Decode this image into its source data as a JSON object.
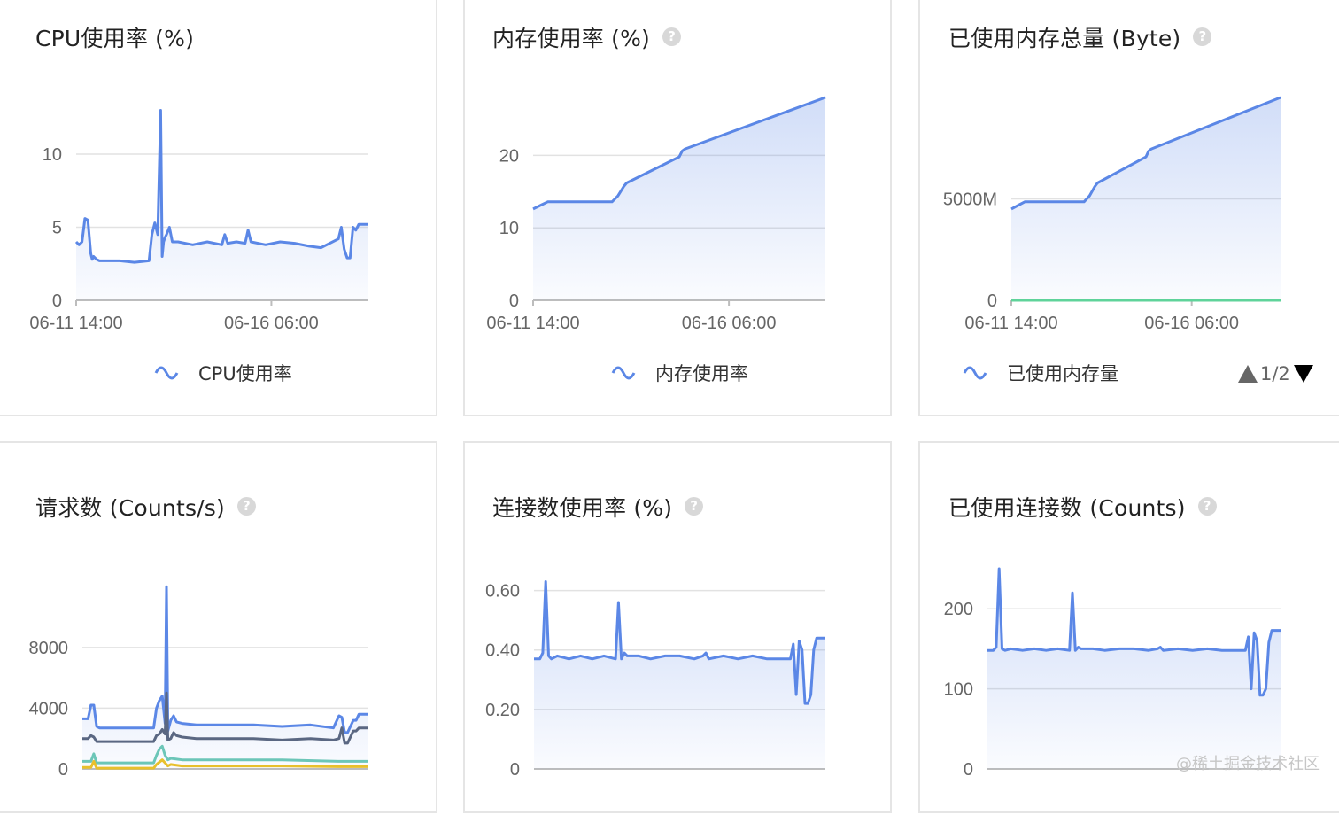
{
  "watermark": "@稀土掘金技术社区",
  "colors": {
    "blue": "#5b87e6",
    "green": "#5fd39a",
    "dark": "#5a6782",
    "teal": "#6cc6b8",
    "yellow": "#e8c02c",
    "grid": "#e2e2e2"
  },
  "panels": [
    {
      "title": "CPU使用率 (%)",
      "help": false,
      "legend": "CPU使用率"
    },
    {
      "title": "内存使用率 (%)",
      "help": true,
      "legend": "内存使用率"
    },
    {
      "title": "已使用内存总量 (Byte)",
      "help": true,
      "legend": "已使用内存量",
      "pager": "1/2"
    },
    {
      "title": "请求数 (Counts/s)",
      "help": true
    },
    {
      "title": "连接数使用率 (%)",
      "help": true
    },
    {
      "title": "已使用连接数 (Counts)",
      "help": true
    }
  ],
  "help_glyph": "?",
  "chart_data": [
    {
      "type": "line",
      "title": "CPU使用率 (%)",
      "ylim": [
        0,
        14
      ],
      "yticks": [
        0,
        5,
        10
      ],
      "ytick_labels": [
        "0",
        "5",
        "10"
      ],
      "xlim": [
        0,
        100
      ],
      "xticks": [
        0,
        67
      ],
      "xtick_labels": [
        "06-11 14:00",
        "06-16 06:00"
      ],
      "series": [
        {
          "name": "CPU使用率",
          "color": "#5b87e6",
          "x": [
            0,
            1,
            2,
            3,
            4,
            5,
            5.5,
            6,
            7,
            8,
            10,
            15,
            20,
            25,
            26,
            27,
            28,
            29,
            29.5,
            30,
            30.5,
            31,
            32,
            33,
            34,
            35,
            40,
            45,
            50,
            51,
            52,
            55,
            58,
            59,
            60,
            65,
            70,
            75,
            80,
            84,
            90,
            91,
            92,
            93,
            94,
            95,
            96,
            97,
            98,
            100
          ],
          "y": [
            4,
            3.8,
            4,
            5.6,
            5.5,
            3.2,
            2.8,
            3.0,
            2.8,
            2.7,
            2.7,
            2.7,
            2.6,
            2.7,
            4.5,
            5.3,
            4.5,
            13,
            3,
            4,
            4.3,
            4.5,
            5,
            4,
            4,
            4,
            3.8,
            4,
            3.8,
            4.5,
            3.9,
            4,
            3.9,
            4.8,
            4,
            3.8,
            4,
            3.9,
            3.7,
            3.6,
            4.2,
            5,
            3.5,
            2.9,
            2.9,
            5,
            4.8,
            5.2,
            5.2,
            5.2
          ]
        }
      ]
    },
    {
      "type": "area",
      "title": "内存使用率 (%)",
      "ylim": [
        0,
        28
      ],
      "yticks": [
        0,
        10,
        20
      ],
      "ytick_labels": [
        "0",
        "10",
        "20"
      ],
      "xlim": [
        0,
        100
      ],
      "xticks": [
        0,
        67
      ],
      "xtick_labels": [
        "06-11 14:00",
        "06-16 06:00"
      ],
      "series": [
        {
          "name": "内存使用率",
          "color": "#5b87e6",
          "x": [
            0,
            3,
            5,
            27,
            29,
            31,
            32,
            50,
            51,
            52,
            100
          ],
          "y": [
            12.6,
            13.2,
            13.6,
            13.6,
            14.4,
            15.7,
            16.2,
            19.8,
            20.6,
            20.9,
            28
          ]
        }
      ]
    },
    {
      "type": "area",
      "title": "已使用内存总量 (Byte)",
      "ylim": [
        0,
        14000
      ],
      "yticks": [
        0,
        7000
      ],
      "ytick_labels": [
        "0",
        "5000M"
      ],
      "xlim": [
        0,
        100
      ],
      "xticks": [
        0,
        67
      ],
      "xtick_labels": [
        "06-11 14:00",
        "06-16 06:00"
      ],
      "series": [
        {
          "name": "已使用内存量",
          "color": "#5b87e6",
          "x": [
            0,
            3,
            5,
            27,
            29,
            31,
            32,
            50,
            51,
            52,
            100
          ],
          "y": [
            6300,
            6600,
            6800,
            6800,
            7200,
            7850,
            8100,
            9900,
            10300,
            10450,
            14000
          ]
        },
        {
          "name": "",
          "color": "#5fd39a",
          "x": [
            0,
            100
          ],
          "y": [
            0,
            0
          ]
        }
      ]
    },
    {
      "type": "line",
      "title": "请求数 (Counts/s)",
      "ylim": [
        0,
        14000
      ],
      "yticks": [
        0,
        4000,
        8000
      ],
      "ytick_labels": [
        "0",
        "4000",
        "8000"
      ],
      "xlim": [
        0,
        100
      ],
      "xticks": [],
      "xtick_labels": [],
      "series": [
        {
          "name": "",
          "color": "#5b87e6",
          "x": [
            0,
            2,
            3,
            4,
            5,
            6,
            10,
            20,
            25,
            26,
            27,
            28,
            29,
            29.5,
            30,
            31,
            32,
            33,
            35,
            40,
            50,
            60,
            70,
            80,
            88,
            90,
            91,
            92,
            93,
            95,
            96,
            97,
            100
          ],
          "y": [
            3300,
            3300,
            4200,
            4200,
            2800,
            2700,
            2700,
            2700,
            2700,
            4000,
            4500,
            4800,
            3000,
            12000,
            2500,
            3200,
            3500,
            3100,
            3000,
            2900,
            2900,
            2900,
            2800,
            2900,
            2700,
            3500,
            3400,
            2400,
            2400,
            3200,
            3200,
            3600,
            3600
          ]
        },
        {
          "name": "",
          "color": "#5a6782",
          "x": [
            0,
            2,
            3,
            4,
            5,
            10,
            20,
            25,
            26,
            27,
            28,
            29,
            29.5,
            30,
            31,
            32,
            33,
            35,
            40,
            50,
            60,
            70,
            80,
            88,
            90,
            91,
            92,
            93,
            95,
            96,
            97,
            100
          ],
          "y": [
            2000,
            2000,
            2200,
            2100,
            1800,
            1800,
            1800,
            1800,
            2200,
            2300,
            2600,
            2300,
            5000,
            1900,
            2000,
            2400,
            2200,
            2100,
            2000,
            2000,
            2000,
            1900,
            2000,
            1900,
            2000,
            2700,
            1700,
            1700,
            2500,
            2500,
            2700,
            2700
          ]
        },
        {
          "name": "",
          "color": "#6cc6b8",
          "x": [
            0,
            3,
            4,
            5,
            10,
            20,
            25,
            26,
            27,
            28,
            29,
            30,
            31,
            35,
            50,
            70,
            90,
            100
          ],
          "y": [
            500,
            500,
            1000,
            400,
            400,
            400,
            400,
            900,
            1300,
            1500,
            900,
            600,
            700,
            600,
            600,
            600,
            500,
            500
          ]
        },
        {
          "name": "",
          "color": "#e8c02c",
          "x": [
            0,
            3,
            4,
            5,
            10,
            25,
            26,
            28,
            29,
            30,
            31,
            35,
            50,
            70,
            90,
            100
          ],
          "y": [
            100,
            100,
            500,
            50,
            50,
            50,
            300,
            600,
            400,
            200,
            300,
            200,
            200,
            200,
            150,
            150
          ]
        }
      ]
    },
    {
      "type": "area",
      "title": "连接数使用率 (%)",
      "ylim": [
        0,
        0.7
      ],
      "yticks": [
        0,
        0.2,
        0.4,
        0.6
      ],
      "ytick_labels": [
        "0",
        "0.20",
        "0.40",
        "0.60"
      ],
      "xlim": [
        0,
        100
      ],
      "xticks": [],
      "xtick_labels": [],
      "series": [
        {
          "name": "",
          "color": "#5b87e6",
          "x": [
            0,
            2,
            3,
            4,
            5,
            6,
            8,
            12,
            16,
            20,
            24,
            28,
            29,
            30,
            31,
            32,
            36,
            40,
            45,
            50,
            55,
            58,
            59,
            60,
            65,
            70,
            75,
            80,
            85,
            88,
            89,
            90,
            91,
            92,
            93,
            94,
            95,
            96,
            97,
            98,
            100
          ],
          "y": [
            0.37,
            0.37,
            0.39,
            0.63,
            0.38,
            0.37,
            0.38,
            0.37,
            0.38,
            0.37,
            0.38,
            0.37,
            0.56,
            0.37,
            0.39,
            0.38,
            0.38,
            0.37,
            0.38,
            0.38,
            0.37,
            0.38,
            0.39,
            0.37,
            0.38,
            0.37,
            0.38,
            0.37,
            0.37,
            0.37,
            0.42,
            0.25,
            0.43,
            0.4,
            0.22,
            0.22,
            0.25,
            0.4,
            0.44,
            0.44,
            0.44
          ]
        }
      ]
    },
    {
      "type": "area",
      "title": "已使用连接数 (Counts)",
      "ylim": [
        0,
        260
      ],
      "yticks": [
        0,
        100,
        200
      ],
      "ytick_labels": [
        "0",
        "100",
        "200"
      ],
      "xlim": [
        0,
        100
      ],
      "xticks": [],
      "xtick_labels": [],
      "series": [
        {
          "name": "",
          "color": "#5b87e6",
          "x": [
            0,
            2,
            3,
            4,
            5,
            6,
            8,
            12,
            16,
            20,
            24,
            28,
            29,
            30,
            31,
            32,
            36,
            40,
            45,
            50,
            55,
            58,
            59,
            60,
            65,
            70,
            75,
            80,
            85,
            88,
            89,
            90,
            91,
            92,
            93,
            94,
            95,
            96,
            97,
            98,
            100
          ],
          "y": [
            148,
            148,
            152,
            250,
            150,
            148,
            150,
            148,
            150,
            148,
            150,
            148,
            220,
            148,
            152,
            150,
            150,
            148,
            150,
            150,
            148,
            150,
            152,
            148,
            150,
            148,
            150,
            148,
            148,
            148,
            165,
            100,
            170,
            160,
            92,
            92,
            100,
            158,
            173,
            173,
            173
          ]
        }
      ]
    }
  ]
}
